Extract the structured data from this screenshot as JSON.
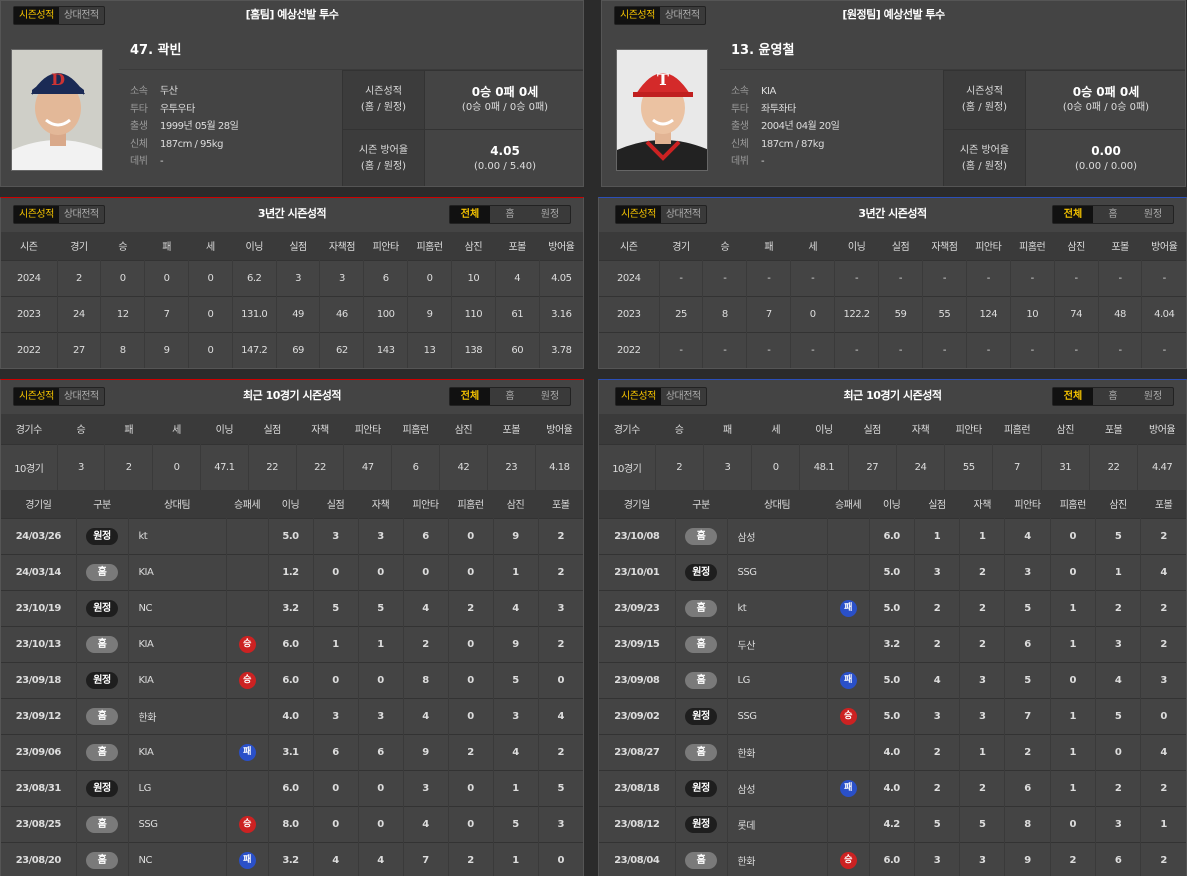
{
  "tabs": {
    "season": "시즌성적",
    "h2h": "상대전적"
  },
  "filters": {
    "all": "전체",
    "home": "홈",
    "away": "원정"
  },
  "profile_labels": {
    "team": "소속",
    "hand": "투타",
    "birth": "출생",
    "body": "신체",
    "debut": "데뷔"
  },
  "stat_labels": {
    "record_1": "시즌성적",
    "record_2": "(홈 / 원정)",
    "era_1": "시즌 방어율",
    "era_2": "(홈 / 원정)"
  },
  "three_year_title": "3년간 시즌성적",
  "recent_title": "최근 10경기 시즌성적",
  "season_headers": [
    "시즌",
    "경기",
    "승",
    "패",
    "세",
    "이닝",
    "실점",
    "자책점",
    "피안타",
    "피홈런",
    "삼진",
    "포볼",
    "방어율"
  ],
  "recent_headers": [
    "경기수",
    "승",
    "패",
    "세",
    "이닝",
    "실점",
    "자책",
    "피안타",
    "피홈런",
    "삼진",
    "포볼",
    "방어율"
  ],
  "game_headers": [
    "경기일",
    "구분",
    "상대팀",
    "승패세",
    "이닝",
    "실점",
    "자책",
    "피안타",
    "피홈런",
    "삼진",
    "포볼"
  ],
  "players": [
    {
      "title": "[홈팀] 예상선발 투수",
      "name": "47. 곽빈",
      "team": "두산",
      "hand": "우투우타",
      "birth": "1999년 05월 28일",
      "body": "187cm / 95kg",
      "debut": "-",
      "record": "0승 0패 0세",
      "record_split": "(0승 0패 / 0승 0패)",
      "era": "4.05",
      "era_split": "(0.00 / 5.40)",
      "cap_color": "#1a2a55",
      "cap_logo": "D",
      "jersey_color": "#f2f2f2",
      "seasons": [
        [
          "2024",
          "2",
          "0",
          "0",
          "0",
          "6.2",
          "3",
          "3",
          "6",
          "0",
          "10",
          "4",
          "4.05"
        ],
        [
          "2023",
          "24",
          "12",
          "7",
          "0",
          "131.0",
          "49",
          "46",
          "100",
          "9",
          "110",
          "61",
          "3.16"
        ],
        [
          "2022",
          "27",
          "8",
          "9",
          "0",
          "147.2",
          "69",
          "62",
          "143",
          "13",
          "138",
          "60",
          "3.78"
        ]
      ],
      "recent": [
        "10경기",
        "3",
        "2",
        "0",
        "47.1",
        "22",
        "22",
        "47",
        "6",
        "42",
        "23",
        "4.18"
      ],
      "games": [
        [
          "24/03/26",
          "원정",
          "kt",
          "",
          "5.0",
          "3",
          "3",
          "6",
          "0",
          "9",
          "2"
        ],
        [
          "24/03/14",
          "홈",
          "KIA",
          "",
          "1.2",
          "0",
          "0",
          "0",
          "0",
          "1",
          "2"
        ],
        [
          "23/10/19",
          "원정",
          "NC",
          "",
          "3.2",
          "5",
          "5",
          "4",
          "2",
          "4",
          "3"
        ],
        [
          "23/10/13",
          "홈",
          "KIA",
          "승",
          "6.0",
          "1",
          "1",
          "2",
          "0",
          "9",
          "2"
        ],
        [
          "23/09/18",
          "원정",
          "KIA",
          "승",
          "6.0",
          "0",
          "0",
          "8",
          "0",
          "5",
          "0"
        ],
        [
          "23/09/12",
          "홈",
          "한화",
          "",
          "4.0",
          "3",
          "3",
          "4",
          "0",
          "3",
          "4"
        ],
        [
          "23/09/06",
          "홈",
          "KIA",
          "패",
          "3.1",
          "6",
          "6",
          "9",
          "2",
          "4",
          "2"
        ],
        [
          "23/08/31",
          "원정",
          "LG",
          "",
          "6.0",
          "0",
          "0",
          "3",
          "0",
          "1",
          "5"
        ],
        [
          "23/08/25",
          "홈",
          "SSG",
          "승",
          "8.0",
          "0",
          "0",
          "4",
          "0",
          "5",
          "3"
        ],
        [
          "23/08/20",
          "홈",
          "NC",
          "패",
          "3.2",
          "4",
          "4",
          "7",
          "2",
          "1",
          "0"
        ]
      ]
    },
    {
      "title": "[원정팀] 예상선발 투수",
      "name": "13. 윤영철",
      "team": "KIA",
      "hand": "좌투좌타",
      "birth": "2004년 04월 20일",
      "body": "187cm / 87kg",
      "debut": "-",
      "record": "0승 0패 0세",
      "record_split": "(0승 0패 / 0승 0패)",
      "era": "0.00",
      "era_split": "(0.00 / 0.00)",
      "cap_color": "#d42a2a",
      "cap_logo": "T",
      "jersey_color": "#222",
      "seasons": [
        [
          "2024",
          "-",
          "-",
          "-",
          "-",
          "-",
          "-",
          "-",
          "-",
          "-",
          "-",
          "-",
          "-"
        ],
        [
          "2023",
          "25",
          "8",
          "7",
          "0",
          "122.2",
          "59",
          "55",
          "124",
          "10",
          "74",
          "48",
          "4.04"
        ],
        [
          "2022",
          "-",
          "-",
          "-",
          "-",
          "-",
          "-",
          "-",
          "-",
          "-",
          "-",
          "-",
          "-"
        ]
      ],
      "recent": [
        "10경기",
        "2",
        "3",
        "0",
        "48.1",
        "27",
        "24",
        "55",
        "7",
        "31",
        "22",
        "4.47"
      ],
      "games": [
        [
          "23/10/08",
          "홈",
          "삼성",
          "",
          "6.0",
          "1",
          "1",
          "4",
          "0",
          "5",
          "2"
        ],
        [
          "23/10/01",
          "원정",
          "SSG",
          "",
          "5.0",
          "3",
          "2",
          "3",
          "0",
          "1",
          "4"
        ],
        [
          "23/09/23",
          "홈",
          "kt",
          "패",
          "5.0",
          "2",
          "2",
          "5",
          "1",
          "2",
          "2"
        ],
        [
          "23/09/15",
          "홈",
          "두산",
          "",
          "3.2",
          "2",
          "2",
          "6",
          "1",
          "3",
          "2"
        ],
        [
          "23/09/08",
          "홈",
          "LG",
          "패",
          "5.0",
          "4",
          "3",
          "5",
          "0",
          "4",
          "3"
        ],
        [
          "23/09/02",
          "원정",
          "SSG",
          "승",
          "5.0",
          "3",
          "3",
          "7",
          "1",
          "5",
          "0"
        ],
        [
          "23/08/27",
          "홈",
          "한화",
          "",
          "4.0",
          "2",
          "1",
          "2",
          "1",
          "0",
          "4"
        ],
        [
          "23/08/18",
          "원정",
          "삼성",
          "패",
          "4.0",
          "2",
          "2",
          "6",
          "1",
          "2",
          "2"
        ],
        [
          "23/08/12",
          "원정",
          "롯데",
          "",
          "4.2",
          "5",
          "5",
          "8",
          "0",
          "3",
          "1"
        ],
        [
          "23/08/04",
          "홈",
          "한화",
          "승",
          "6.0",
          "3",
          "3",
          "9",
          "2",
          "6",
          "2"
        ]
      ]
    }
  ]
}
